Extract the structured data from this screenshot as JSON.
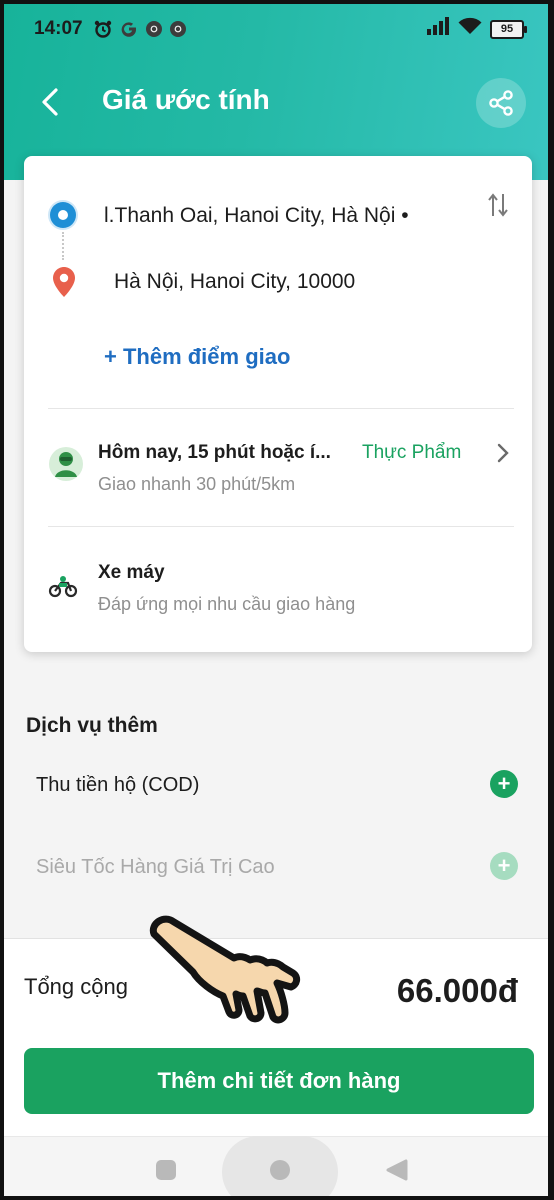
{
  "status_bar": {
    "time": "14:07",
    "battery": "95"
  },
  "header": {
    "title": "Giá ước tính"
  },
  "route": {
    "from": "l.Thanh Oai, Hanoi City, Hà Nội •",
    "to": "Hà Nội, Hanoi City, 10000",
    "add_stop": "+ Thêm điểm giao"
  },
  "delivery": {
    "title": "Hôm nay, 15 phút hoặc í...",
    "subtitle": "Giao nhanh 30 phút/5km",
    "tag": "Thực Phẩm"
  },
  "vehicle": {
    "title": "Xe máy",
    "subtitle": "Đáp ứng mọi nhu cầu giao hàng"
  },
  "extras": {
    "title": "Dịch vụ thêm",
    "items": [
      {
        "label": "Thu tiền hộ (COD)"
      },
      {
        "label": "Siêu Tốc Hàng Giá Trị Cao"
      }
    ]
  },
  "total": {
    "label": "Tổng cộng",
    "value": "66.000đ"
  },
  "cta": {
    "label": "Thêm chi tiết đơn hàng"
  },
  "colors": {
    "accent": "#1aa260",
    "link": "#1f6dc1",
    "header": "#24b9a6"
  },
  "icons": [
    "alarm-icon",
    "g-icon",
    "chrome-icon",
    "signal-icon",
    "wifi-icon",
    "battery-icon",
    "back-arrow-icon",
    "share-icon",
    "origin-dot-icon",
    "destination-pin-icon",
    "swap-icon",
    "driver-avatar-icon",
    "chevron-right-icon",
    "motorbike-icon",
    "plus-icon",
    "pointing-hand-icon",
    "square-nav-icon",
    "circle-nav-icon",
    "triangle-nav-icon"
  ]
}
